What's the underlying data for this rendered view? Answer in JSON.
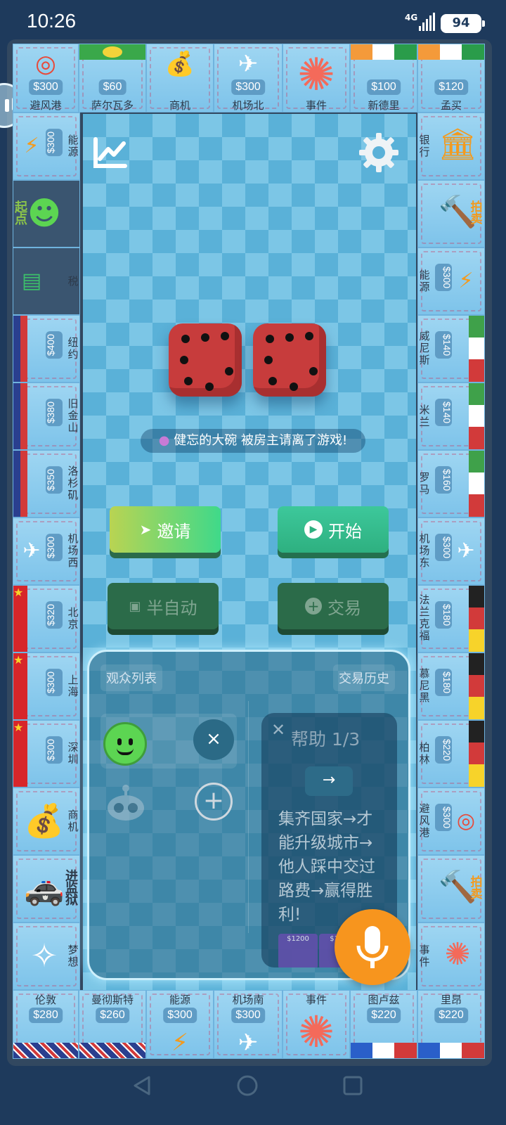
{
  "status": {
    "time": "10:26",
    "network": "4G",
    "battery": "94"
  },
  "top_row": [
    {
      "name": "避风港",
      "price": "$300"
    },
    {
      "name": "萨尔瓦多",
      "price": "$60"
    },
    {
      "name": "商机",
      "price": ""
    },
    {
      "name": "机场北",
      "price": "$300"
    },
    {
      "name": "事件",
      "price": ""
    },
    {
      "name": "新德里",
      "price": "$100"
    },
    {
      "name": "孟买",
      "price": "$120"
    }
  ],
  "left_col": [
    {
      "name": "能源",
      "price": "$300"
    },
    {
      "name": "起点",
      "price": ""
    },
    {
      "name": "税",
      "price": ""
    },
    {
      "name": "纽约",
      "price": "$400"
    },
    {
      "name": "旧金山",
      "price": "$380"
    },
    {
      "name": "洛杉矶",
      "price": "$350"
    },
    {
      "name": "机场西",
      "price": "$300"
    },
    {
      "name": "北京",
      "price": "$320"
    },
    {
      "name": "上海",
      "price": "$300"
    },
    {
      "name": "深圳",
      "price": "$300"
    },
    {
      "name": "商机",
      "price": ""
    },
    {
      "name": "进监狱",
      "price": ""
    },
    {
      "name": "梦想",
      "price": ""
    }
  ],
  "right_col": [
    {
      "name": "银行",
      "price": ""
    },
    {
      "name": "拍卖",
      "price": ""
    },
    {
      "name": "能源",
      "price": "$300"
    },
    {
      "name": "威尼斯",
      "price": "$140"
    },
    {
      "name": "米兰",
      "price": "$140"
    },
    {
      "name": "罗马",
      "price": "$160"
    },
    {
      "name": "机场东",
      "price": "$300"
    },
    {
      "name": "法兰克福",
      "price": "$180"
    },
    {
      "name": "慕尼黑",
      "price": "$180"
    },
    {
      "name": "柏林",
      "price": "$220"
    },
    {
      "name": "避风港",
      "price": "$300"
    },
    {
      "name": "拍卖",
      "price": ""
    },
    {
      "name": "事件",
      "price": ""
    }
  ],
  "bottom_row": [
    {
      "name": "伦敦",
      "price": "$280"
    },
    {
      "name": "曼彻斯特",
      "price": "$260"
    },
    {
      "name": "能源",
      "price": "$300"
    },
    {
      "name": "机场南",
      "price": "$300"
    },
    {
      "name": "事件",
      "price": ""
    },
    {
      "name": "图卢兹",
      "price": "$220"
    },
    {
      "name": "里昂",
      "price": "$220"
    }
  ],
  "notice": "健忘的大碗 被房主请离了游戏!",
  "buttons": {
    "invite": "邀请",
    "start": "开始",
    "semi_auto": "半自动",
    "trade": "交易"
  },
  "panel": {
    "audience_tab": "观众列表",
    "history_tab": "交易历史",
    "help_title": "帮助 1/3",
    "help_text": "集齐国家→才能升级城市→他人踩中交过路费→赢得胜利!",
    "mini_prices": [
      "$1200",
      "$115"
    ]
  },
  "colors": {
    "accent": "#f7951e",
    "board": "#5ab1d8",
    "cell": "#9fd6f2"
  }
}
